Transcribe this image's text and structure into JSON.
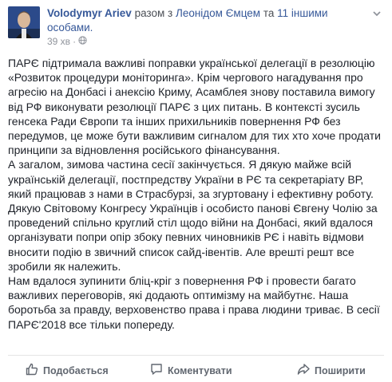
{
  "post": {
    "author": "Volodymyr Ariev",
    "with_prefix": "разом з",
    "tagged_person": "Леонідом Ємцем",
    "and_word": "та",
    "others_link_line1": "11 іншими",
    "others_link_line2": "особами.",
    "time": "39 хв",
    "paragraphs": [
      "ПАРЄ підтримала важливі поправки української делегації в резолюцію «Розвиток процедури моніторинга». Крім чергового нагадування про агресію на Донбасі і анексію Криму, Асамблея знову поставила вимогу від РФ виконувати резолюції ПАРЄ з цих питань. В контексті зусиль генсека Ради Європи та інших прихильників повернення РФ без передумов, це може бути важливим сигналом для тих хто хоче продати принципи за відновлення російського фінансування.",
      "А загалом, зимова частина сесії закінчується. Я дякую майже всій українській делегації, постпредству України в РЄ та секретаріату ВР, який працював з нами в Страсбурзі, за згуртованy і ефективну роботу. Дякую Світовому Конгресу Українців і особисто панові Євгену Чолію за проведений спільно круглий стіл щодо війни на Донбасі, який вдалося організувати попри опір збоку певних чиновників РЄ і навіть відмови вносити подію в звичний список сайд-івентів. Але врешті решт все зробили як належить.",
      "Нам вдалося зупинити бліц-кріг з повернення РФ і провести багато важливих переговорів, які додають оптимізму на майбутнє. Наша боротьба за правду, верховенство права і права людини триває. В сесії ПАРЄ'2018 все тільки попереду."
    ]
  },
  "actions": {
    "like_label": "Подобається",
    "comment_label": "Коментувати",
    "share_label": "Поширити"
  },
  "icons": {
    "like": "thumbs-up-icon",
    "comment": "speech-bubble-icon",
    "share": "share-arrow-icon",
    "privacy": "globe-icon",
    "menu": "chevron-down-icon"
  },
  "colors": {
    "link": "#365899",
    "meta": "#90949c",
    "action": "#616770",
    "text": "#1d2129"
  }
}
